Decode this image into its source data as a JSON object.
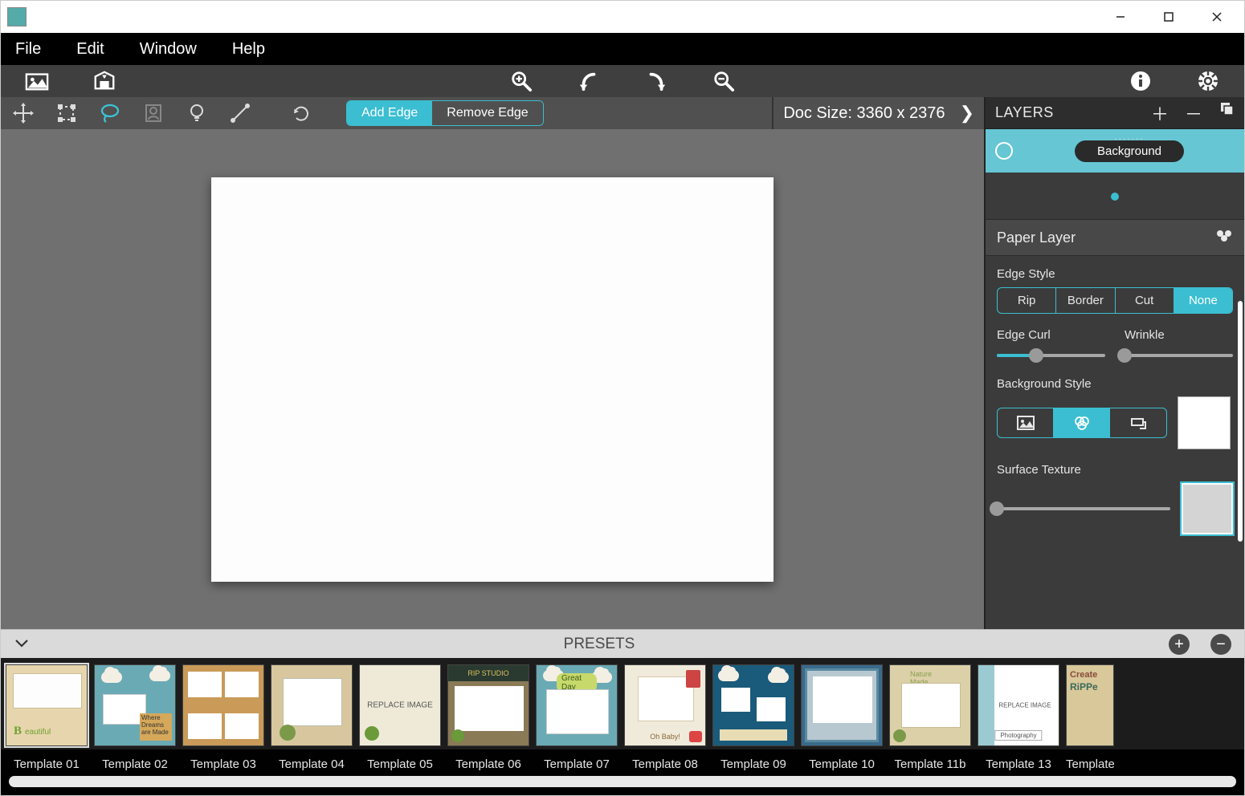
{
  "menubar": {
    "file": "File",
    "edit": "Edit",
    "window": "Window",
    "help": "Help"
  },
  "toolbar": {
    "add_edge": "Add Edge",
    "remove_edge": "Remove Edge"
  },
  "doc_size": {
    "label": "Doc Size: 3360 x 2376"
  },
  "layers": {
    "title": "LAYERS",
    "items": [
      {
        "label": "Background"
      }
    ]
  },
  "panel": {
    "title": "Paper Layer",
    "edge_style_label": "Edge Style",
    "edge_styles": {
      "rip": "Rip",
      "border": "Border",
      "cut": "Cut",
      "none": "None"
    },
    "edge_style_active": "none",
    "edge_curl_label": "Edge Curl",
    "edge_curl_value": 36,
    "wrinkle_label": "Wrinkle",
    "wrinkle_value": 0,
    "bg_style_label": "Background Style",
    "bg_style_active_index": 1,
    "surface_texture_label": "Surface Texture",
    "surface_texture_value": 0
  },
  "presets": {
    "title": "PRESETS",
    "items": [
      {
        "label": "Template 01"
      },
      {
        "label": "Template 02"
      },
      {
        "label": "Template 03"
      },
      {
        "label": "Template 04"
      },
      {
        "label": "Template 05"
      },
      {
        "label": "Template 06"
      },
      {
        "label": "Template 07"
      },
      {
        "label": "Template 08"
      },
      {
        "label": "Template 09"
      },
      {
        "label": "Template 10"
      },
      {
        "label": "Template 11b"
      },
      {
        "label": "Template 13"
      },
      {
        "label": "Template"
      }
    ]
  }
}
